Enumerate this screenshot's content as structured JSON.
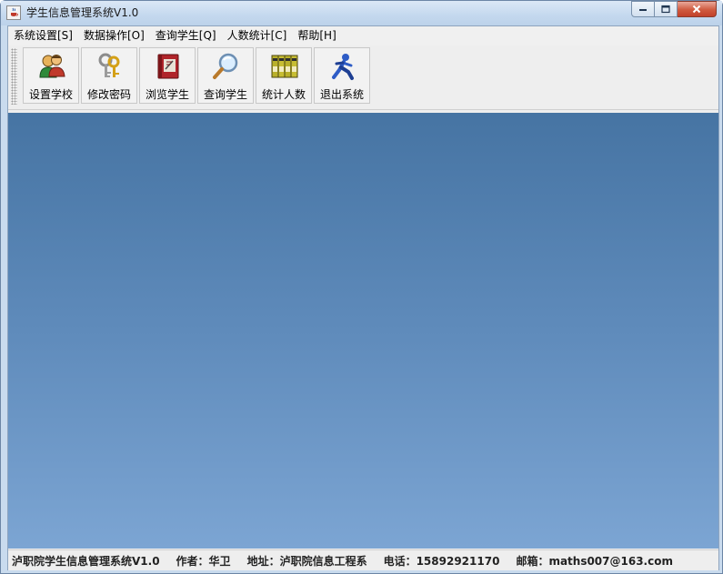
{
  "window": {
    "title": "学生信息管理系统V1.0"
  },
  "menu": [
    {
      "label": "系统设置[S]"
    },
    {
      "label": "数据操作[O]"
    },
    {
      "label": "查询学生[Q]"
    },
    {
      "label": "人数统计[C]"
    },
    {
      "label": "帮助[H]"
    }
  ],
  "toolbar": [
    {
      "label": "设置学校",
      "icon": "users-icon"
    },
    {
      "label": "修改密码",
      "icon": "keys-icon"
    },
    {
      "label": "浏览学生",
      "icon": "book-icon"
    },
    {
      "label": "查询学生",
      "icon": "magnifier-icon"
    },
    {
      "label": "统计人数",
      "icon": "binders-icon"
    },
    {
      "label": "退出系统",
      "icon": "running-man-icon"
    }
  ],
  "statusbar": {
    "system": "泸职院学生信息管理系统V1.0",
    "author": "作者：华卫",
    "address": "地址：泸职院信息工程系",
    "phone": "电话：15892921170",
    "email": "邮箱：maths007@163.com"
  },
  "colors": {
    "desktop_top": "#4674a3",
    "desktop_bottom": "#7ca5d3",
    "close_button": "#cf5a3f"
  }
}
